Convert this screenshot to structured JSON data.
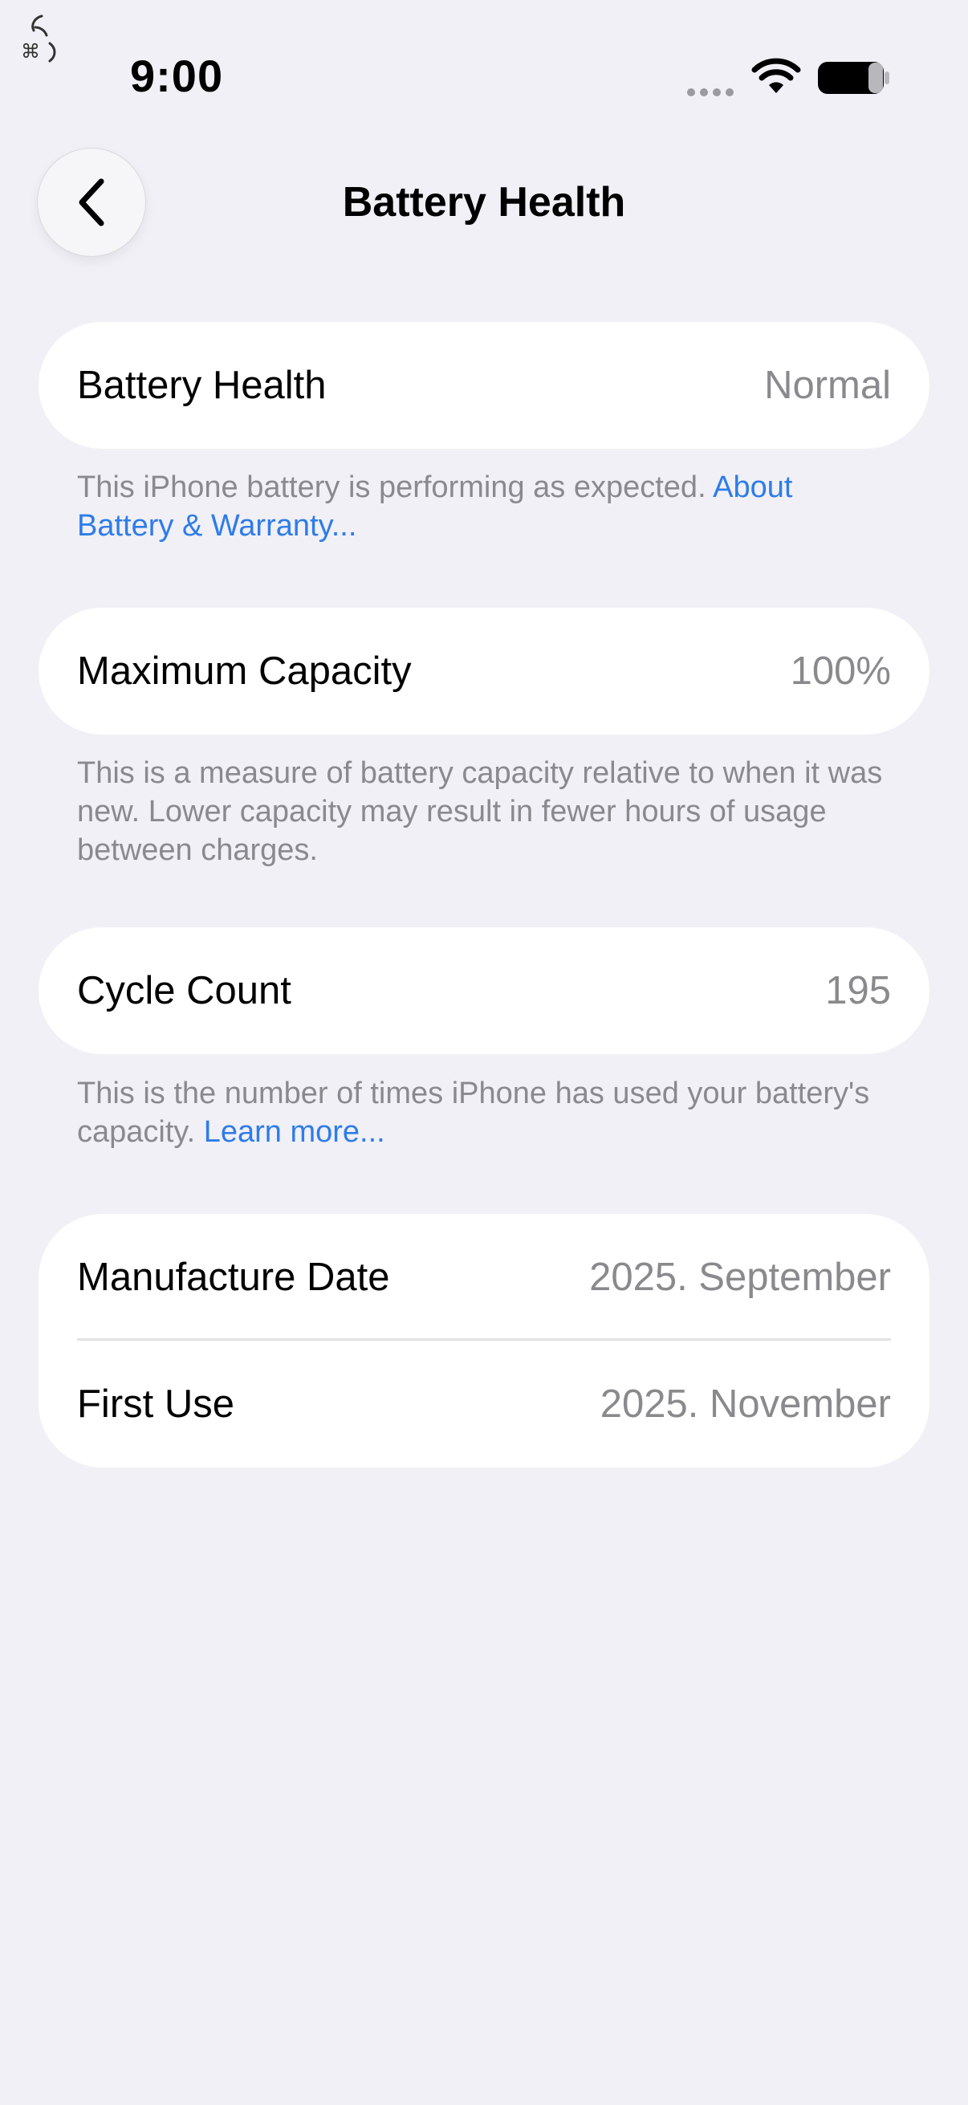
{
  "status_bar": {
    "time": "9:00"
  },
  "nav": {
    "title": "Battery Health"
  },
  "battery_health": {
    "label": "Battery Health",
    "value": "Normal",
    "note": "This iPhone battery is performing as expected. ",
    "note_link": "About Battery & Warranty..."
  },
  "maximum_capacity": {
    "label": "Maximum Capacity",
    "value": "100%",
    "note": "This is a measure of battery capacity relative to when it was new. Lower capacity may result in fewer hours of usage between charges."
  },
  "cycle_count": {
    "label": "Cycle Count",
    "value": "195",
    "note": "This is the number of times iPhone has used your battery's capacity. ",
    "note_link": "Learn more..."
  },
  "dates": {
    "manufacture_label": "Manufacture Date",
    "manufacture_value": "2025. September",
    "first_use_label": "First Use",
    "first_use_value": "2025. November"
  },
  "colors": {
    "background": "#F0F0F6",
    "card": "#FFFFFF",
    "secondary_text": "#8A8A8E",
    "link": "#2F7CE8"
  }
}
